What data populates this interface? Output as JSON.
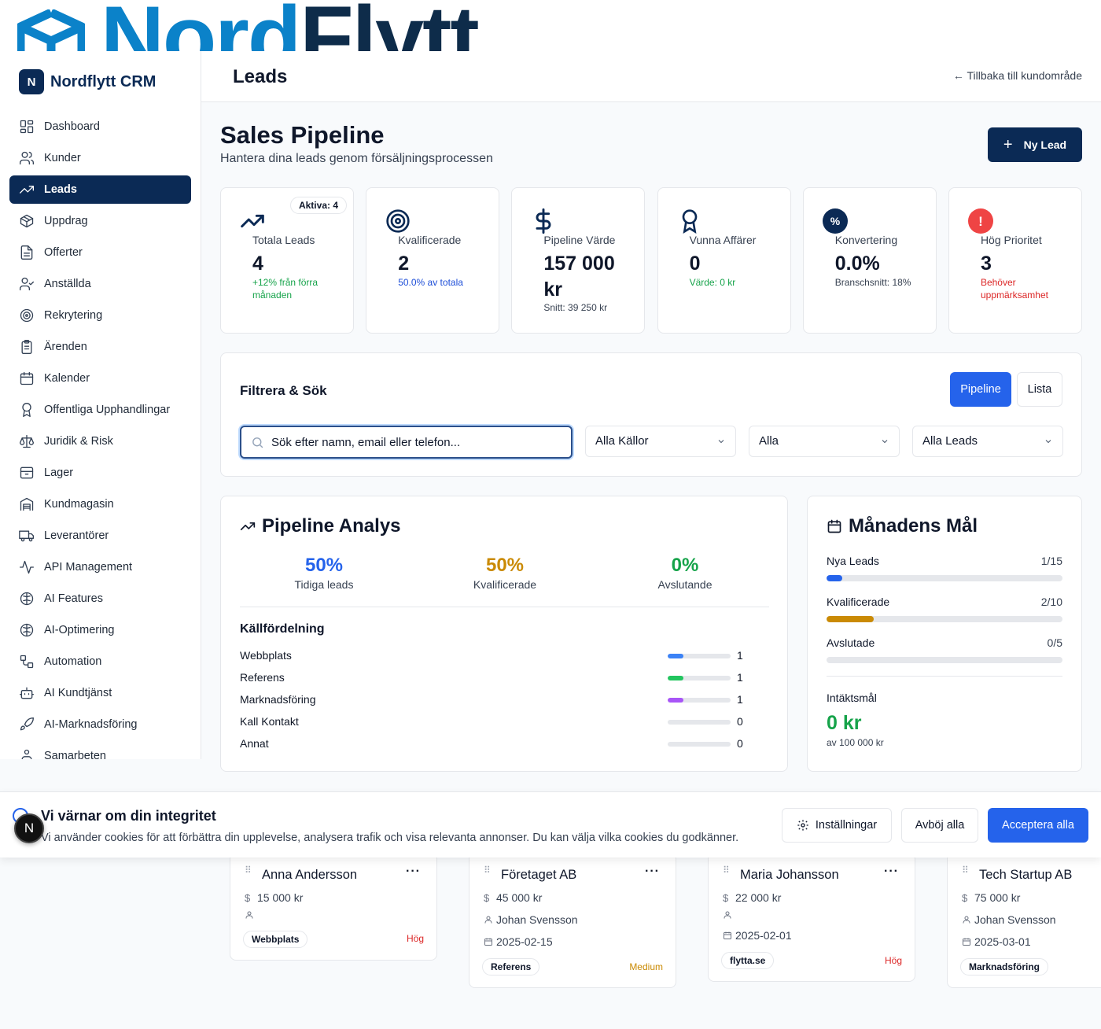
{
  "brand_banner": {
    "word_a": "Nord",
    "word_b": "Flytt"
  },
  "sidebar": {
    "badge": "N",
    "title": "Nordflytt CRM",
    "items": [
      {
        "label": "Dashboard",
        "icon": "dashboard-icon"
      },
      {
        "label": "Kunder",
        "icon": "users-icon"
      },
      {
        "label": "Leads",
        "icon": "trending-up-icon",
        "active": true
      },
      {
        "label": "Uppdrag",
        "icon": "package-icon"
      },
      {
        "label": "Offerter",
        "icon": "document-icon"
      },
      {
        "label": "Anställda",
        "icon": "user-check-icon"
      },
      {
        "label": "Rekrytering",
        "icon": "target-icon"
      },
      {
        "label": "Ärenden",
        "icon": "clipboard-icon"
      },
      {
        "label": "Kalender",
        "icon": "calendar-icon"
      },
      {
        "label": "Offentliga Upphandlingar",
        "icon": "award-icon"
      },
      {
        "label": "Juridik & Risk",
        "icon": "scale-icon"
      },
      {
        "label": "Lager",
        "icon": "archive-icon"
      },
      {
        "label": "Kundmagasin",
        "icon": "warehouse-icon"
      },
      {
        "label": "Leverantörer",
        "icon": "truck-icon"
      },
      {
        "label": "API Management",
        "icon": "activity-icon"
      },
      {
        "label": "AI Features",
        "icon": "brain-icon"
      },
      {
        "label": "AI-Optimering",
        "icon": "brain-icon"
      },
      {
        "label": "Automation",
        "icon": "workflow-icon"
      },
      {
        "label": "AI Kundtjänst",
        "icon": "bot-icon"
      },
      {
        "label": "AI-Marknadsföring",
        "icon": "rocket-icon"
      },
      {
        "label": "Samarbeten",
        "icon": "handshake-icon"
      }
    ]
  },
  "header": {
    "title": "Leads",
    "back_link": "← Tillbaka till kundområde"
  },
  "hero": {
    "title": "Sales Pipeline",
    "subtitle": "Hantera dina leads genom försäljningsprocessen",
    "new_lead": "Ny Lead"
  },
  "stats": [
    {
      "label": "Totala Leads",
      "value": "4",
      "sub": "+12% från förra månaden",
      "sub_color": "#16a34a",
      "pill": "Aktiva: 4",
      "icon": "trending-up-icon"
    },
    {
      "label": "Kvalificerade",
      "value": "2",
      "sub": "50.0% av totala",
      "sub_color": "#1d4ed8",
      "icon": "target-icon"
    },
    {
      "label": "Pipeline Värde",
      "value": "157 000 kr",
      "sub": "Snitt: 39 250 kr",
      "sub_color": "#374151",
      "icon": "dollar-icon"
    },
    {
      "label": "Vunna Affärer",
      "value": "0",
      "sub": "Värde: 0 kr",
      "sub_color": "#16a34a",
      "icon": "award-icon"
    },
    {
      "label": "Konvertering",
      "value": "0.0%",
      "sub": "Branschsnitt: 18%",
      "sub_color": "#374151",
      "icon": "percent-icon"
    },
    {
      "label": "Hög Prioritet",
      "value": "3",
      "sub": "Behöver uppmärksamhet",
      "sub_color": "#dc2626",
      "icon": "alert-icon"
    }
  ],
  "filter": {
    "title": "Filtrera & Sök",
    "view_pipeline": "Pipeline",
    "view_list": "Lista",
    "search_placeholder": "Sök efter namn, email eller telefon...",
    "source_select": "Alla Källor",
    "priority_select": "Alla",
    "leads_select": "Alla Leads"
  },
  "analys": {
    "title": "Pipeline Analys",
    "kpis": [
      {
        "value": "50%",
        "label": "Tidiga leads",
        "color": "#2563eb"
      },
      {
        "value": "50%",
        "label": "Kvalificerade",
        "color": "#ca8a04"
      },
      {
        "value": "0%",
        "label": "Avslutande",
        "color": "#16a34a"
      }
    ],
    "sources_title": "Källfördelning",
    "sources": [
      {
        "name": "Webbplats",
        "count": "1",
        "fraction": 0.25,
        "color": "#3b82f6"
      },
      {
        "name": "Referens",
        "count": "1",
        "fraction": 0.25,
        "color": "#22c55e"
      },
      {
        "name": "Marknadsföring",
        "count": "1",
        "fraction": 0.25,
        "color": "#a855f7"
      },
      {
        "name": "Kall Kontakt",
        "count": "0",
        "fraction": 0,
        "color": "#9ca3af"
      },
      {
        "name": "Annat",
        "count": "0",
        "fraction": 0,
        "color": "#9ca3af"
      }
    ]
  },
  "goals": {
    "title": "Månadens Mål",
    "rows": [
      {
        "name": "Nya Leads",
        "value": "1/15",
        "fraction": 0.0667,
        "color": "#2563eb"
      },
      {
        "name": "Kvalificerade",
        "value": "2/10",
        "fraction": 0.2,
        "color": "#ca8a04"
      },
      {
        "name": "Avslutade",
        "value": "0/5",
        "fraction": 0,
        "color": "#16a34a"
      }
    ],
    "revenue_title": "Intäktsmål",
    "revenue_value": "0 kr",
    "revenue_sub": "av 100 000 kr"
  },
  "leads": [
    {
      "name": "Anna Andersson",
      "value": "15 000 kr",
      "owner": "",
      "date": "",
      "tag": "Webbplats",
      "priority": "Hög",
      "priority_color": "#dc2626"
    },
    {
      "name": "Företaget AB",
      "value": "45 000 kr",
      "owner": "Johan Svensson",
      "date": "2025-02-15",
      "tag": "Referens",
      "priority": "Medium",
      "priority_color": "#ca8a04"
    },
    {
      "name": "Maria Johansson",
      "value": "22 000 kr",
      "owner": "",
      "date": "2025-02-01",
      "tag": "flytta.se",
      "priority": "Hög",
      "priority_color": "#dc2626"
    },
    {
      "name": "Tech Startup AB",
      "value": "75 000 kr",
      "owner": "Johan Svensson",
      "date": "2025-03-01",
      "tag": "Marknadsföring",
      "priority": "",
      "priority_color": "#dc2626"
    }
  ],
  "cookie": {
    "title": "Vi värnar om din integritet",
    "text": "Vi använder cookies för att förbättra din upplevelse, analysera trafik och visa relevanta annonser. Du kan välja vilka cookies du godkänner.",
    "settings": "Inställningar",
    "reject": "Avböj alla",
    "accept": "Acceptera alla"
  },
  "dev_badge": "N"
}
